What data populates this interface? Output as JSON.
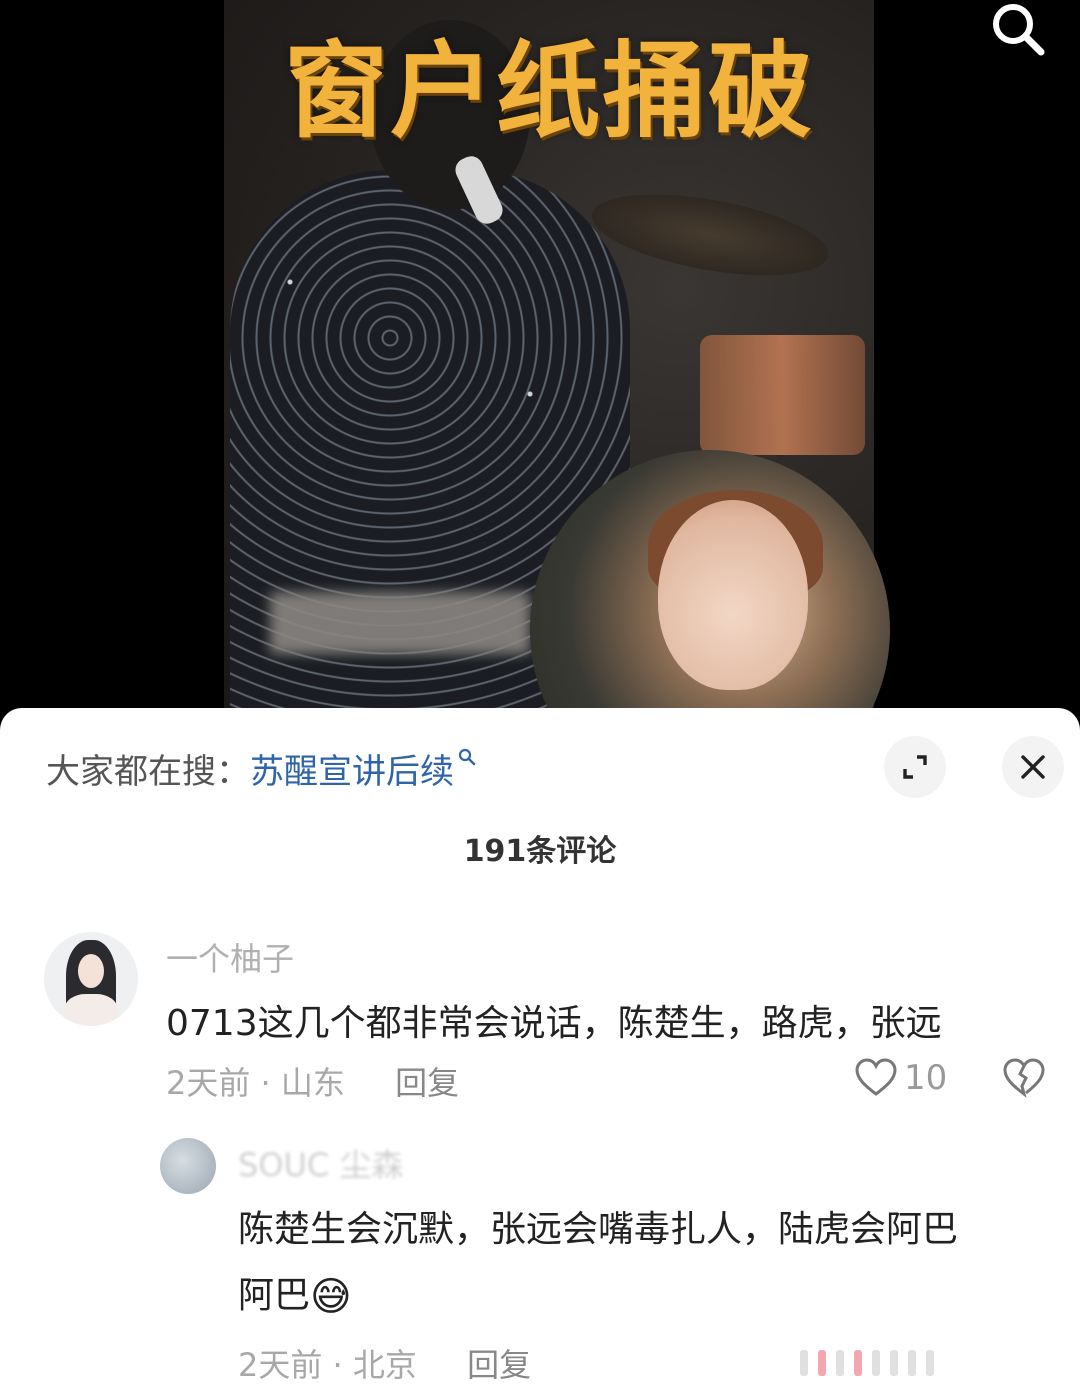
{
  "video": {
    "title_overlay": "窗户纸捅破"
  },
  "panel": {
    "hot_search_label": "大家都在搜：",
    "hot_search_term": "苏醒宣讲后续",
    "comment_count": "191条评论"
  },
  "comments": [
    {
      "username": "一个柚子",
      "text": "0713这几个都非常会说话，陈楚生，路虎，张远",
      "time": "2天前",
      "location": "山东",
      "reply_label": "回复",
      "likes": "10"
    },
    {
      "username": "SOUC 尘森",
      "text_line1": "陈楚生会沉默，张远会嘴毒扎人，陆虎会阿巴",
      "text_line2": "阿巴",
      "emoji": "😅",
      "time": "2天前",
      "location": "北京",
      "reply_label": "回复"
    }
  ],
  "colors": {
    "title_gold": "#f2b33d",
    "hot_term_blue": "#2f64a8",
    "panel_bg": "#ffffff"
  },
  "icons": [
    "search-icon",
    "expand-icon",
    "close-icon",
    "heart-icon",
    "broken-heart-icon"
  ]
}
